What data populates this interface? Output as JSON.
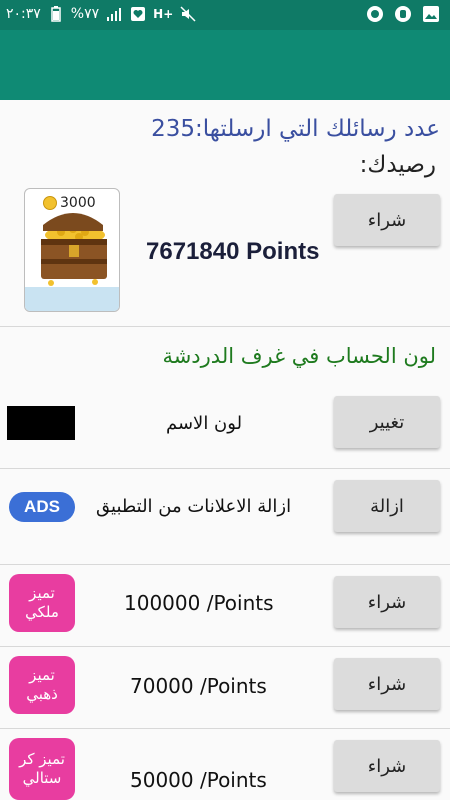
{
  "status_bar": {
    "time": "٢٠:٣٧",
    "battery": "%٧٧",
    "network": "H+"
  },
  "colors": {
    "status_bar": "#0f7a66",
    "app_bar": "#0f8a74",
    "message_count_text": "#3a4fa0",
    "section_title_text": "#1e7a1e",
    "ads_badge": "#3b6fd6",
    "tier_badge": "#e83da0",
    "name_color_swatch": "#000000"
  },
  "account": {
    "messages_sent": "عدد رسائلك التي ارسلتها:235",
    "balance_label": "رصيدك:",
    "chest_coins": "3000",
    "points_total": "7671840 Points",
    "buy_label": "شراء"
  },
  "chat_color": {
    "title": "لون الحساب في غرف الدردشة",
    "name_color_label": "لون الاسم",
    "change_label": "تغيير"
  },
  "ads": {
    "remove_ads_label": "ازالة الاعلانات من التطبيق",
    "remove_label": "ازالة",
    "badge": "ADS"
  },
  "tiers": [
    {
      "badge": "تميز\nملكي",
      "price": "100000 /Points",
      "buy_label": "شراء"
    },
    {
      "badge": "تميز\nذهبي",
      "price": "70000 /Points",
      "buy_label": "شراء"
    },
    {
      "badge": "تميز كر\nستالي",
      "price": "50000 /Points",
      "buy_label": "شراء"
    }
  ]
}
